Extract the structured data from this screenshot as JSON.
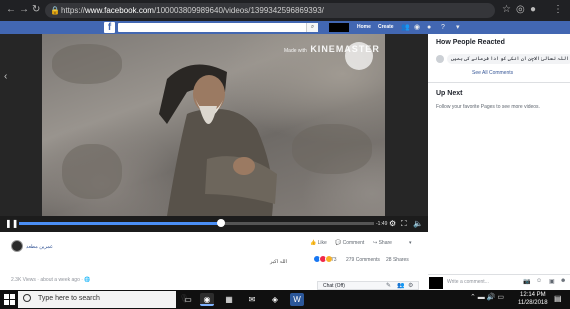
{
  "browser": {
    "url_prefix": "https://",
    "url_domain": "www.facebook.com",
    "url_path": "/100003809989640/videos/1399342596869393/",
    "back_icon": "arrow-left-icon",
    "forward_icon": "arrow-right-icon",
    "reload_icon": "reload-icon"
  },
  "fb_header": {
    "logo": "f",
    "home_label": "Home",
    "create_label": "Create",
    "icons": [
      "friends-icon",
      "messenger-icon",
      "notifications-icon",
      "help-icon",
      "menu-caret-icon"
    ]
  },
  "video": {
    "watermark_prefix": "Made with",
    "watermark_brand": "KINEMASTER",
    "time_remaining": "-1:49",
    "progress_fraction": 0.57
  },
  "post": {
    "page_name": "عمرین مطعد",
    "like_label": "Like",
    "comment_label": "Comment",
    "share_label": "Share",
    "reaction_count": "73",
    "comments_count": "279 Comments",
    "shares_count": "28 Shares",
    "views_text": "2.3K Views",
    "time_text": "about a week ago",
    "small_text": "اللہ اکبر"
  },
  "right_panel": {
    "how_reacted": "How People Reacted",
    "top_comment": "اللہ تعالیٰ الاچن ان انکی کو ادا فرمانے کی ہمیں",
    "see_all": "See All Comments",
    "up_next": "Up Next",
    "follow_text": "Follow your favorite Pages to see more videos.",
    "write_placeholder": "Write a comment..."
  },
  "chat": {
    "label": "Chat (Off)"
  },
  "taskbar": {
    "search_placeholder": "Type here to search",
    "time": "12:14 PM",
    "date": "11/28/2018"
  },
  "colors": {
    "facebook_blue": "#4267b2",
    "progress_blue": "#4b8ff5",
    "taskbar": "#101010"
  }
}
